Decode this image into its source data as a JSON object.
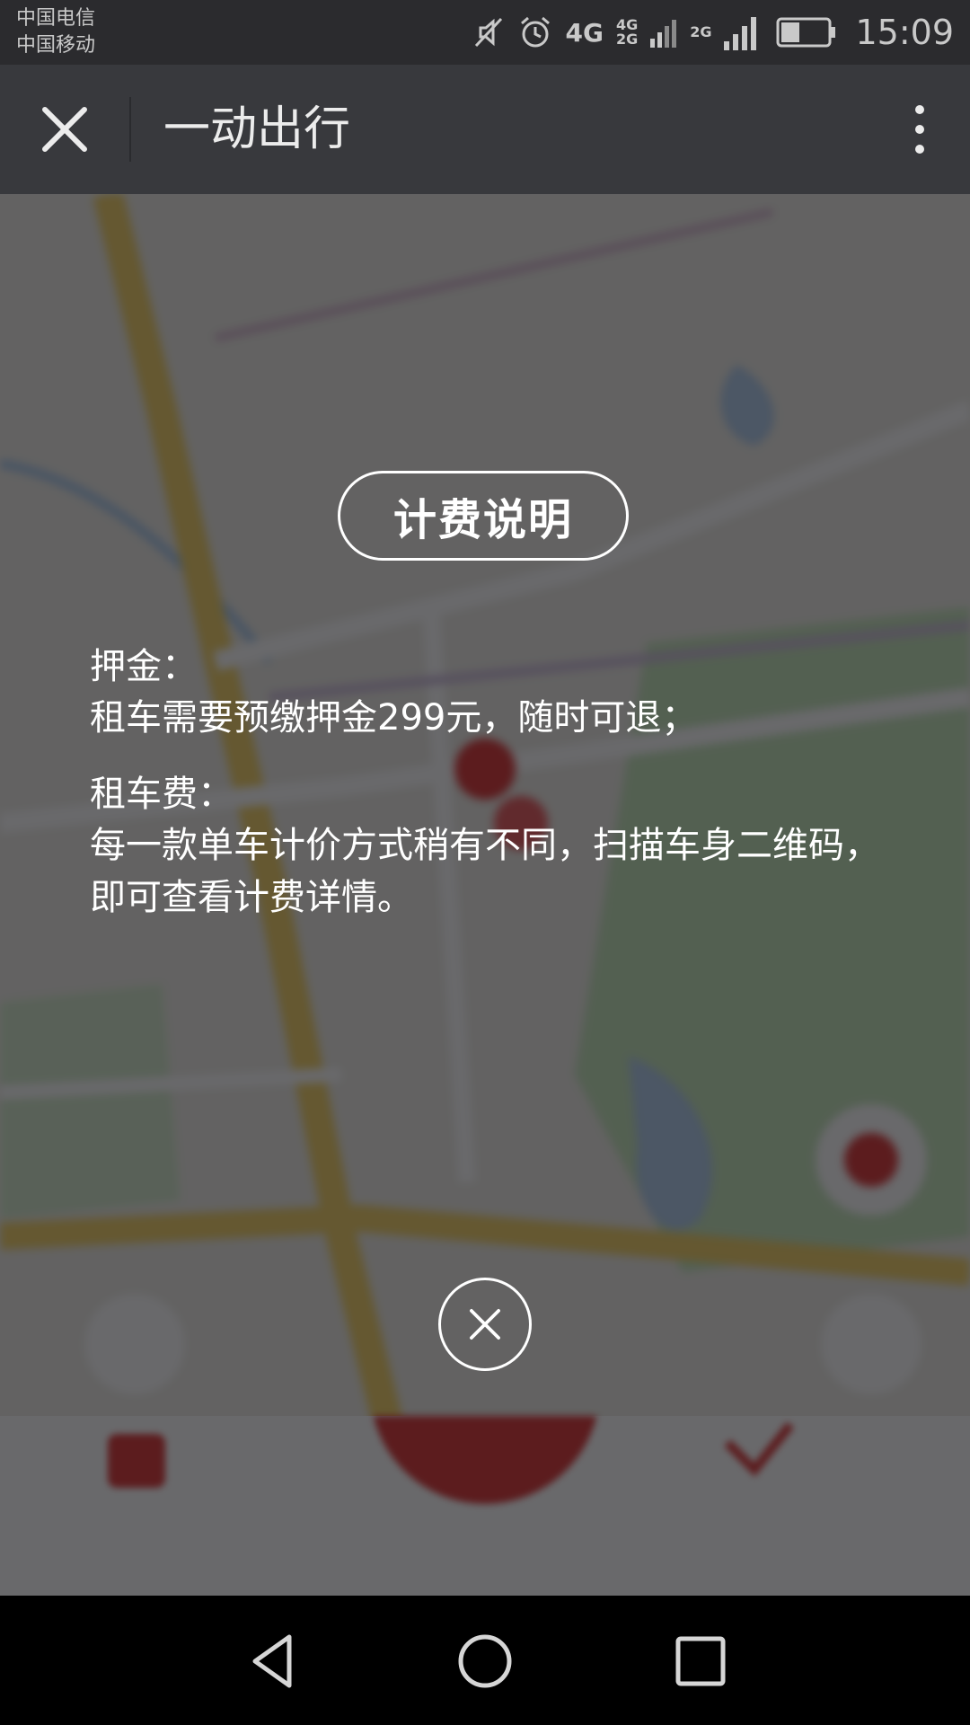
{
  "status_bar": {
    "carrier_1": "中国电信",
    "carrier_2": "中国移动",
    "network_primary": "4G",
    "network_secondary_top": "4G",
    "network_secondary_bottom": "2G",
    "network_tertiary": "2G",
    "battery_level": 0.4,
    "time": "15:09",
    "icons": [
      "mute-icon",
      "alarm-icon",
      "signal-icon",
      "battery-icon"
    ]
  },
  "title_bar": {
    "title": "一动出行",
    "icons": [
      "close-icon",
      "more-vertical-icon"
    ]
  },
  "fee_modal": {
    "title": "计费说明",
    "deposit_heading": "押金：",
    "deposit_text": "租车需要预缴押金299元，随时可退；",
    "rental_heading": "租车费：",
    "rental_text": "每一款单车计价方式稍有不同，扫描车身二维码，即可查看计费详情。",
    "close_icon": "close-circle-icon"
  },
  "nav_bar": {
    "icons": [
      "back-icon",
      "home-icon",
      "recent-apps-icon"
    ]
  },
  "colors": {
    "status_bar_bg": "#2b2b2e",
    "title_bar_bg": "#38393d",
    "overlay": "rgba(28,28,30,0.66)",
    "brand_red": "#d81e1e",
    "modal_text": "#ffffff"
  }
}
